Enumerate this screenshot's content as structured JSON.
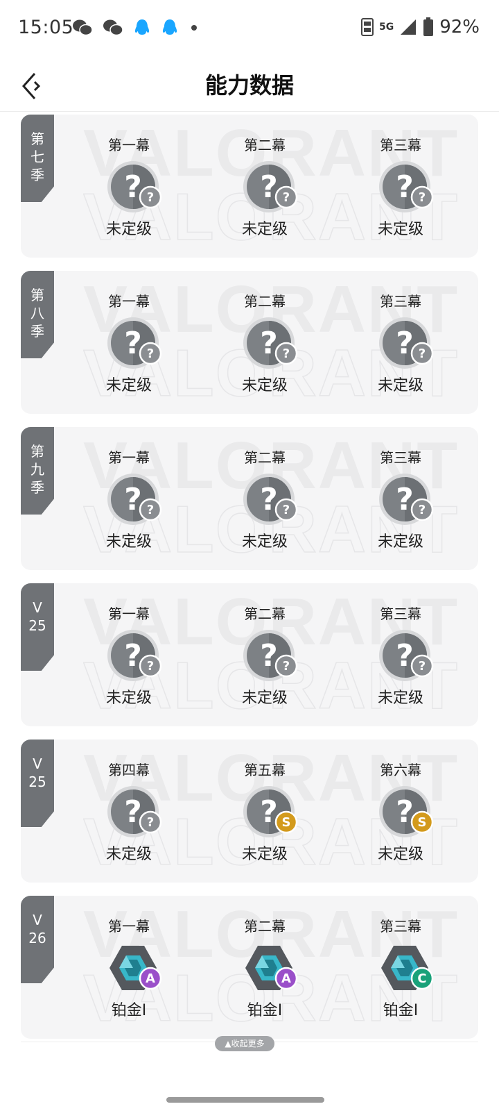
{
  "status_bar": {
    "time": "15:05",
    "notification_icons": [
      "wechat-icon",
      "wechat-icon",
      "qq-icon",
      "qq-icon",
      "dot-icon"
    ],
    "network": "5G",
    "battery": "92%"
  },
  "header": {
    "title": "能力数据",
    "back_icon": "back-icon"
  },
  "watermark_text": "VALORANT",
  "seasons": [
    {
      "tag": [
        "第",
        "七",
        "季"
      ],
      "acts": [
        {
          "title": "第一幕",
          "rank": "未定级",
          "state": "unranked",
          "grade": "?"
        },
        {
          "title": "第二幕",
          "rank": "未定级",
          "state": "unranked",
          "grade": "?"
        },
        {
          "title": "第三幕",
          "rank": "未定级",
          "state": "unranked",
          "grade": "?"
        }
      ]
    },
    {
      "tag": [
        "第",
        "八",
        "季"
      ],
      "acts": [
        {
          "title": "第一幕",
          "rank": "未定级",
          "state": "unranked",
          "grade": "?"
        },
        {
          "title": "第二幕",
          "rank": "未定级",
          "state": "unranked",
          "grade": "?"
        },
        {
          "title": "第三幕",
          "rank": "未定级",
          "state": "unranked",
          "grade": "?"
        }
      ]
    },
    {
      "tag": [
        "第",
        "九",
        "季"
      ],
      "acts": [
        {
          "title": "第一幕",
          "rank": "未定级",
          "state": "unranked",
          "grade": "?"
        },
        {
          "title": "第二幕",
          "rank": "未定级",
          "state": "unranked",
          "grade": "?"
        },
        {
          "title": "第三幕",
          "rank": "未定级",
          "state": "unranked",
          "grade": "?"
        }
      ]
    },
    {
      "tag": [
        "V",
        "25"
      ],
      "acts": [
        {
          "title": "第一幕",
          "rank": "未定级",
          "state": "unranked",
          "grade": "?"
        },
        {
          "title": "第二幕",
          "rank": "未定级",
          "state": "unranked",
          "grade": "?"
        },
        {
          "title": "第三幕",
          "rank": "未定级",
          "state": "unranked",
          "grade": "?"
        }
      ]
    },
    {
      "tag": [
        "V",
        "25"
      ],
      "acts": [
        {
          "title": "第四幕",
          "rank": "未定级",
          "state": "unranked",
          "grade": "?"
        },
        {
          "title": "第五幕",
          "rank": "未定级",
          "state": "unranked",
          "grade": "S"
        },
        {
          "title": "第六幕",
          "rank": "未定级",
          "state": "unranked",
          "grade": "S"
        }
      ]
    },
    {
      "tag": [
        "V",
        "26"
      ],
      "acts": [
        {
          "title": "第一幕",
          "rank": "铂金I",
          "state": "platinum",
          "grade": "A"
        },
        {
          "title": "第二幕",
          "rank": "铂金I",
          "state": "platinum",
          "grade": "A"
        },
        {
          "title": "第三幕",
          "rank": "铂金I",
          "state": "platinum",
          "grade": "C"
        }
      ]
    }
  ],
  "collapse_label": "收起更多",
  "colors": {
    "tag_bg": "#6f7276",
    "grade_unknown": "#8a8d91",
    "grade_s": "#d39a1c",
    "grade_a": "#9a4fc9",
    "grade_c": "#1aa27a",
    "platinum": "#38b7c9"
  }
}
